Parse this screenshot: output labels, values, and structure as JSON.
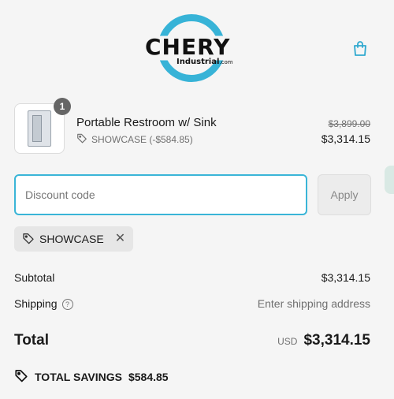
{
  "header": {
    "logo_text": "CHERY",
    "logo_sub": "Industrial",
    "logo_sub_tld": ".com",
    "cart_icon": "shopping-bag-icon"
  },
  "product": {
    "quantity": "1",
    "title": "Portable Restroom w/ Sink",
    "discount_label": "SHOWCASE (-$584.85)",
    "original_price": "$3,899.00",
    "price": "$3,314.15"
  },
  "discount": {
    "placeholder": "Discount code",
    "apply_label": "Apply",
    "applied_code": "SHOWCASE"
  },
  "totals": {
    "subtotal_label": "Subtotal",
    "subtotal_value": "$3,314.15",
    "shipping_label": "Shipping",
    "shipping_value": "Enter shipping address",
    "total_label": "Total",
    "currency": "USD",
    "total_value": "$3,314.15",
    "savings_label": "TOTAL SAVINGS",
    "savings_value": "$584.85"
  },
  "colors": {
    "accent": "#3ab5d7",
    "text": "#1a1a1a",
    "muted": "#707070"
  }
}
